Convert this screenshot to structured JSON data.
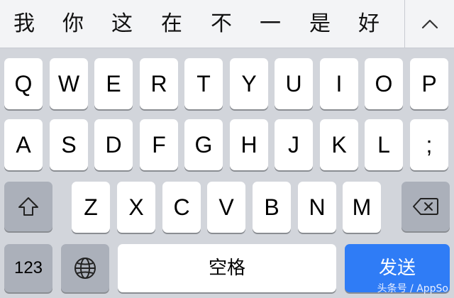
{
  "candidates": [
    "我",
    "你",
    "这",
    "在",
    "不",
    "一",
    "是",
    "好"
  ],
  "row1": [
    "Q",
    "W",
    "E",
    "R",
    "T",
    "Y",
    "U",
    "I",
    "O",
    "P"
  ],
  "row2": [
    "A",
    "S",
    "D",
    "F",
    "G",
    "H",
    "J",
    "K",
    "L",
    ";"
  ],
  "row3": [
    "Z",
    "X",
    "C",
    "V",
    "B",
    "N",
    "M"
  ],
  "bottom": {
    "numbers_label": "123",
    "space_label": "空格",
    "send_label": "发送"
  },
  "icons": {
    "collapse": "chevron-up-icon",
    "shift": "shift-icon",
    "delete": "backspace-icon",
    "globe": "globe-icon"
  },
  "colors": {
    "send": "#2f7cf6",
    "function_key": "#abb0ba",
    "keyboard_bg": "#d2d5db"
  },
  "watermark": "头条号 / AppSo"
}
